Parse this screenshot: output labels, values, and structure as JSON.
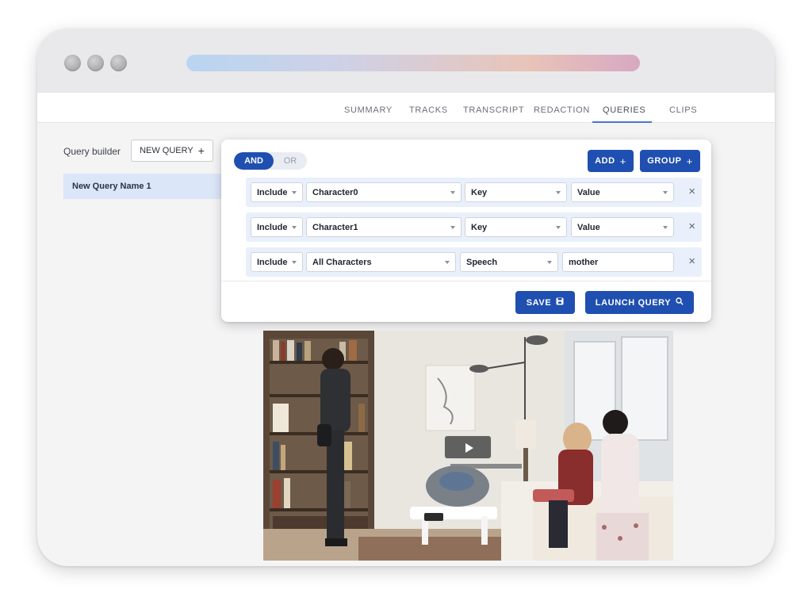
{
  "window": {
    "traffic_lights": [
      "close",
      "minimize",
      "zoom"
    ]
  },
  "nav": {
    "tabs": [
      {
        "label": "SUMMARY",
        "active": false
      },
      {
        "label": "TRACKS",
        "active": false
      },
      {
        "label": "TRANSCRIPT",
        "active": false
      },
      {
        "label": "REDACTION",
        "active": false
      },
      {
        "label": "QUERIES",
        "active": true
      },
      {
        "label": "CLIPS",
        "active": false
      }
    ]
  },
  "sidebar": {
    "label": "Query builder",
    "new_query_label": "NEW QUERY",
    "new_query_icon": "+",
    "items": [
      {
        "label": "New Query Name 1",
        "selected": true
      }
    ]
  },
  "panel": {
    "logic": {
      "and_label": "AND",
      "or_label": "OR",
      "selected": "AND"
    },
    "add_label": "ADD",
    "group_label": "GROUP",
    "plus_symbol": "+",
    "conditions": [
      {
        "mode": "Include",
        "character": "Character0",
        "field": "Key",
        "value": "Value"
      },
      {
        "mode": "Include",
        "character": "Character1",
        "field": "Key",
        "value": "Value"
      },
      {
        "mode": "Include",
        "character": "All Characters",
        "field": "Speech",
        "value": "mother"
      }
    ],
    "remove_symbol": "×",
    "save_label": "SAVE",
    "launch_label": "LAUNCH QUERY"
  },
  "colors": {
    "primary": "#1f4fb0",
    "selected_row": "#dbe6f8",
    "condition_row": "#e9f0fb"
  },
  "icons": {
    "save": "save-icon",
    "search": "search-icon",
    "play": "play-icon"
  }
}
